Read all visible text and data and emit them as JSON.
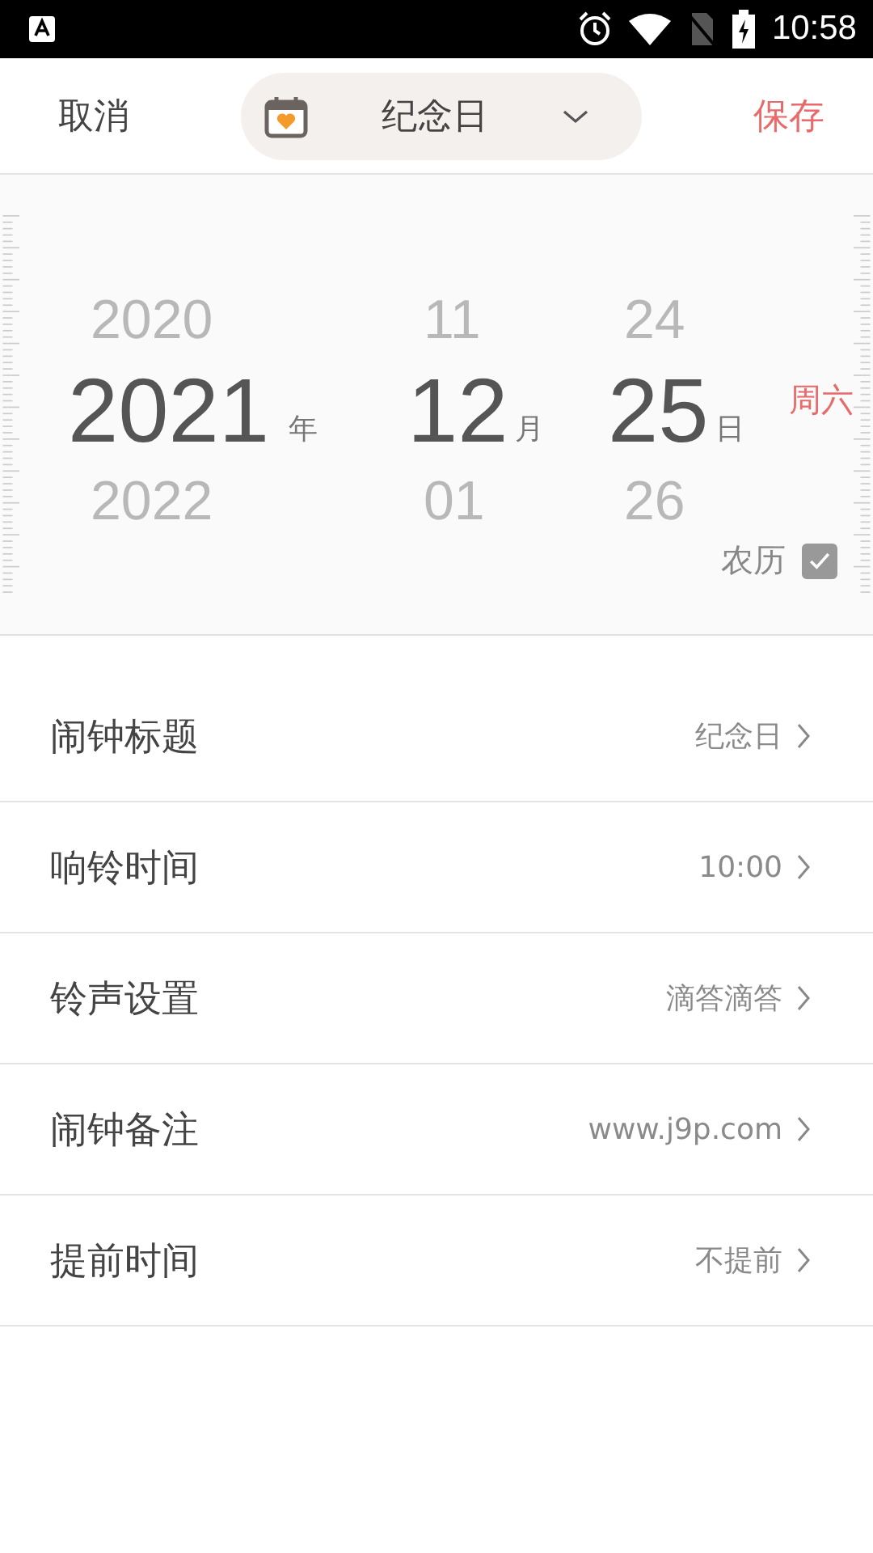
{
  "status_bar": {
    "time": "10:58"
  },
  "header": {
    "cancel": "取消",
    "type_label": "纪念日",
    "save": "保存"
  },
  "picker": {
    "columns": [
      {
        "prev": "2020",
        "current": "2021",
        "unit": "年",
        "next": "2022"
      },
      {
        "prev": "11",
        "current": "12",
        "unit": "月",
        "next": "01"
      },
      {
        "prev": "24",
        "current": "25",
        "unit": "日",
        "next": "26"
      }
    ],
    "weekday": "周六",
    "lunar": {
      "label": "农历",
      "checked": true
    }
  },
  "settings": [
    {
      "label": "闹钟标题",
      "value": "纪念日"
    },
    {
      "label": "响铃时间",
      "value": "10:00"
    },
    {
      "label": "铃声设置",
      "value": "滴答滴答"
    },
    {
      "label": "闹钟备注",
      "value": "www.j9p.com"
    },
    {
      "label": "提前时间",
      "value": "不提前"
    }
  ]
}
